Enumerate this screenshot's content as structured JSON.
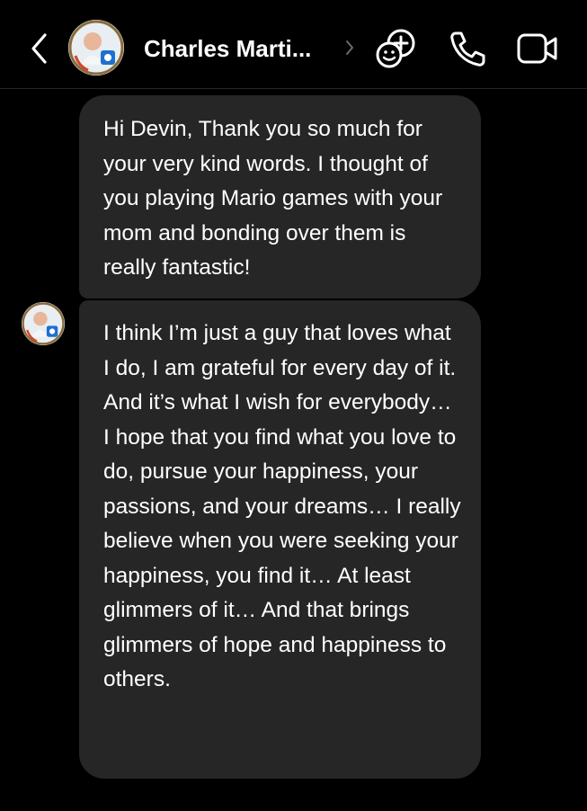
{
  "header": {
    "contact_name": "Charles Marti...",
    "back_icon": "chevron-left-icon",
    "details_icon": "chevron-right-icon",
    "effects_icon": "add-reaction-icon",
    "call_icon": "phone-icon",
    "video_icon": "video-camera-icon"
  },
  "colors": {
    "background": "#000000",
    "bubble": "#262626",
    "text": "#ffffff"
  },
  "messages": [
    {
      "text": "Hi Devin, Thank you so much for your very kind words. I thought of you playing Mario games with your mom and bonding over them is really fantastic!"
    },
    {
      "text": "I think I’m just a guy that loves what I do, I am grateful for every day of it.\nAnd it’s what I wish for everybody… I hope that you find what you love to do, pursue your happiness, your passions, and your dreams… I really believe when you were seeking your happiness, you find it… At least glimmers of it… And that brings glimmers of hope and happiness to others."
    }
  ]
}
